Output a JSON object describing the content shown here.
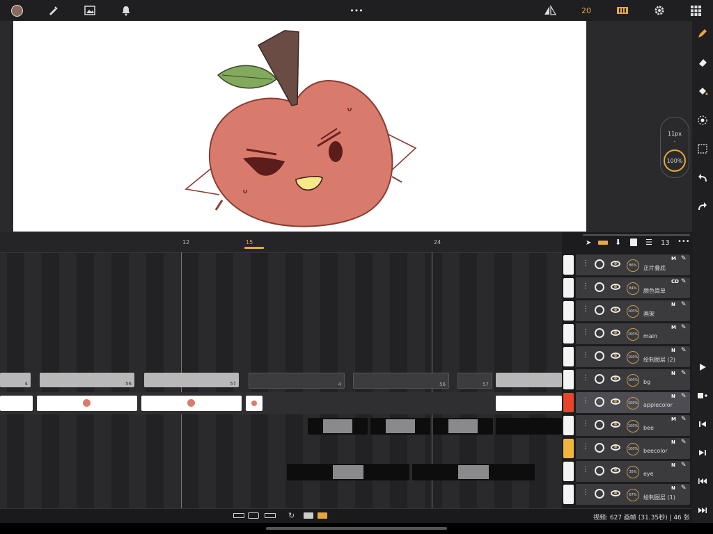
{
  "toolbar": {
    "frame_rate": "20",
    "more": "•••"
  },
  "brush": {
    "size": "11px",
    "separator": "-",
    "opacity": "100%"
  },
  "timeline": {
    "ruler_labels": [
      "12",
      "15",
      "24"
    ],
    "current_frame": "15",
    "track1_cells": [
      "4",
      "56",
      "57",
      "4",
      "56",
      "57"
    ]
  },
  "layer_panel": {
    "count": "13",
    "layers": [
      {
        "name": "正片叠底",
        "mode": "M",
        "opacity": "86%",
        "thumb": "#f4f4f4"
      },
      {
        "name": "颜色简单",
        "mode": "CD",
        "opacity": "84%",
        "thumb": "#f4f4f4"
      },
      {
        "name": "画架",
        "mode": "N",
        "opacity": "100%",
        "thumb": "#f4f4f4"
      },
      {
        "name": "main",
        "mode": "M",
        "opacity": "100%",
        "thumb": "#f4f4f4"
      },
      {
        "name": "绘制图层 (2)",
        "mode": "N",
        "opacity": "100%",
        "thumb": "#f4f4f4"
      },
      {
        "name": "bg",
        "mode": "N",
        "opacity": "100%",
        "thumb": "#f4f4f4"
      },
      {
        "name": "applecolor",
        "mode": "N",
        "opacity": "100%",
        "thumb": "#e8432c"
      },
      {
        "name": "bee",
        "mode": "M",
        "opacity": "100%",
        "thumb": "#f4f4f4"
      },
      {
        "name": "beecolor",
        "mode": "N",
        "opacity": "100%",
        "thumb": "#f2b53a"
      },
      {
        "name": "eye",
        "mode": "N",
        "opacity": "35%",
        "thumb": "#f4f4f4"
      },
      {
        "name": "绘制图层 (1)",
        "mode": "N",
        "opacity": "67%",
        "thumb": "#f4f4f4"
      }
    ]
  },
  "status": {
    "info": "视频: 627 画帧 (31.35秒) | 46 张"
  },
  "colors": {
    "accent": "#e6a83a",
    "apple": "#d97b6c",
    "selected_layer": "#4c4c52"
  }
}
